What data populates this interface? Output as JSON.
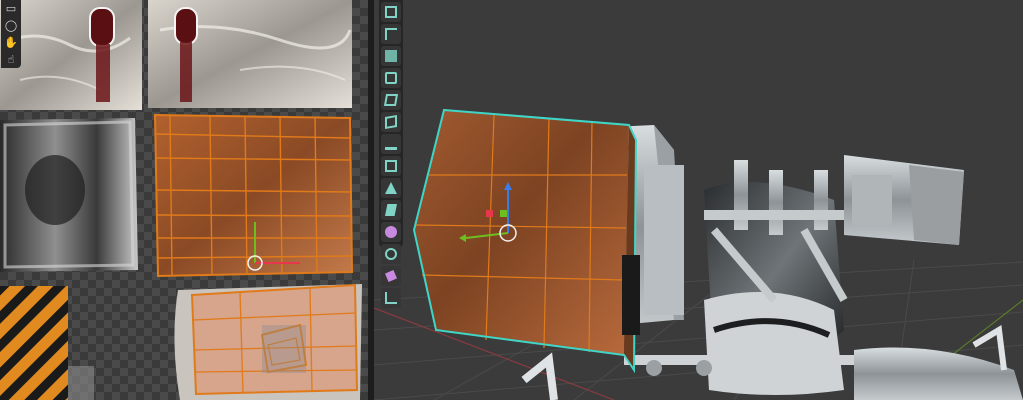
{
  "uv_editor": {
    "tools": [
      {
        "name": "select-box-icon",
        "glyph": "▭"
      },
      {
        "name": "select-circle-icon",
        "glyph": "◯"
      },
      {
        "name": "grab-hand-icon",
        "glyph": "✋"
      },
      {
        "name": "pointer-hand-icon",
        "glyph": "☝"
      }
    ]
  },
  "viewport": {
    "tools": [
      {
        "name": "select-box-icon",
        "color": "#7fd4c6"
      },
      {
        "name": "cursor-icon",
        "color": "#7fd4c6"
      },
      {
        "name": "move-icon",
        "color": "#7fd4c6"
      },
      {
        "name": "rotate-icon",
        "color": "#7fd4c6"
      },
      {
        "name": "scale-icon",
        "color": "#7fd4c6"
      },
      {
        "name": "transform-icon",
        "color": "#7fd4c6"
      },
      {
        "name": "annotate-icon",
        "color": "#7fd4c6"
      },
      {
        "name": "measure-icon",
        "color": "#7fd4c6"
      },
      {
        "name": "add-cube-icon",
        "color": "#7fd4c6"
      },
      {
        "name": "extrude-icon",
        "color": "#7fd4c6"
      },
      {
        "name": "sphere-icon",
        "color": "#c88ae0"
      },
      {
        "name": "spin-icon",
        "color": "#7fd4c6"
      },
      {
        "name": "shear-icon",
        "color": "#c88ae0"
      },
      {
        "name": "rip-icon",
        "color": "#7fd4c6"
      }
    ]
  },
  "colors": {
    "selection_orange": "#e07a1a",
    "active_outline": "#3fd6c8",
    "gizmo_x": "#e8364f",
    "gizmo_y": "#6cbf1f",
    "gizmo_z": "#3b7de8"
  }
}
